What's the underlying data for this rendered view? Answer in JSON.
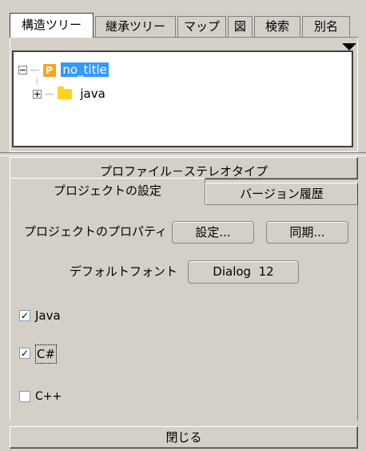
{
  "top_tabs": [
    {
      "label": "構造ツリー",
      "active": true
    },
    {
      "label": "継承ツリー",
      "active": false
    },
    {
      "label": "マップ",
      "active": false
    },
    {
      "label": "図",
      "active": false
    },
    {
      "label": "検索",
      "active": false
    },
    {
      "label": "別名",
      "active": false
    }
  ],
  "tree": {
    "root": {
      "label": "no_title",
      "icon_letter": "P",
      "selected": true,
      "expanded": true
    },
    "children": [
      {
        "label": "java",
        "expanded": false
      }
    ]
  },
  "stereotype_bar_label": "プロファイル－ステレオタイプ",
  "settings_tabs": [
    {
      "label": "プロジェクトの設定",
      "active": true
    },
    {
      "label": "バージョン履歴",
      "active": false
    }
  ],
  "project_properties": {
    "label": "プロジェクトのプロパティ",
    "settings_button": "設定...",
    "sync_button": "同期..."
  },
  "default_font": {
    "label": "デフォルトフォント",
    "value": "Dialog  12"
  },
  "languages": [
    {
      "label": "Java",
      "checked": true
    },
    {
      "label": "C#",
      "checked": true
    },
    {
      "label": "C++",
      "checked": false
    }
  ],
  "close_button": "閉じる",
  "colors": {
    "panel_bg": "#d4d0c8",
    "selection": "#3399ff",
    "folder": "#ffd21f",
    "project_icon": "#f5a623"
  }
}
